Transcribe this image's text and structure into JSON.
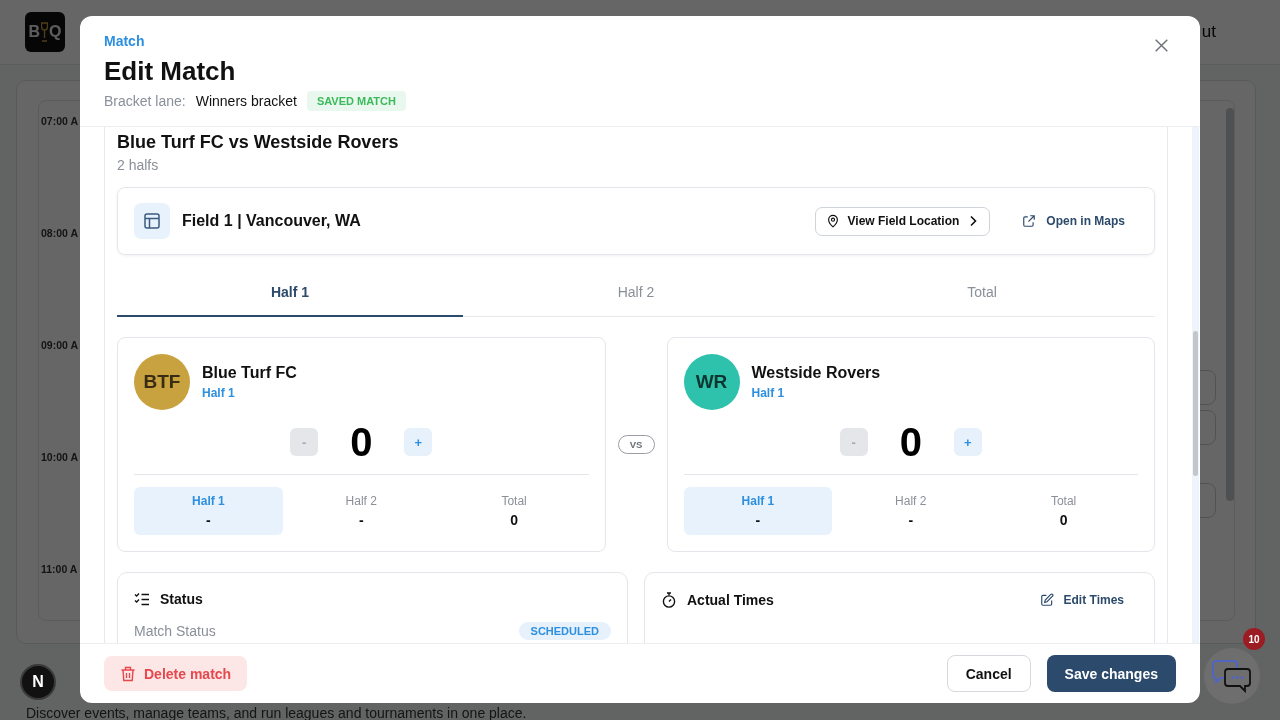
{
  "background": {
    "logo": {
      "letters": [
        "B",
        "Q"
      ]
    },
    "header_link": "ut",
    "time_labels": [
      "07:00 A",
      "08:00 A",
      "09:00 A",
      "10:00 A",
      "11:00 A"
    ],
    "tagline": "Discover events, manage teams, and run leagues and tournaments in one place.",
    "dev_indicator": "N",
    "chat": {
      "badge": "10"
    }
  },
  "modal": {
    "eyebrow": "Match",
    "title": "Edit Match",
    "lane_label": "Bracket lane:",
    "lane": "Winners bracket",
    "badge": "SAVED MATCH"
  },
  "match": {
    "title": "Blue Turf FC vs Westside Rovers",
    "subtitle": "2 halfs",
    "field": {
      "name": "Field 1 | Vancouver, WA",
      "location_button": "View Field Location",
      "maps_link": "Open in Maps"
    },
    "tabs": [
      {
        "label": "Half 1",
        "selected": true
      },
      {
        "label": "Half 2",
        "selected": false
      },
      {
        "label": "Total",
        "selected": false
      }
    ],
    "vs": "VS",
    "teams": [
      {
        "initials": "BTF",
        "color": "#c8a23f",
        "name": "Blue Turf FC",
        "period": "Half 1",
        "score": "0",
        "decrement": {
          "label": "-",
          "disabled": true
        },
        "increment": {
          "label": "+",
          "disabled": false
        },
        "breakdown": [
          {
            "label": "Half 1",
            "value": "-",
            "selected": true
          },
          {
            "label": "Half 2",
            "value": "-",
            "selected": false
          },
          {
            "label": "Total",
            "value": "0",
            "selected": false
          }
        ]
      },
      {
        "initials": "WR",
        "color": "#2ec2ad",
        "name": "Westside Rovers",
        "period": "Half 1",
        "score": "0",
        "decrement": {
          "label": "-",
          "disabled": true
        },
        "increment": {
          "label": "+",
          "disabled": false
        },
        "breakdown": [
          {
            "label": "Half 1",
            "value": "-",
            "selected": true
          },
          {
            "label": "Half 2",
            "value": "-",
            "selected": false
          },
          {
            "label": "Total",
            "value": "0",
            "selected": false
          }
        ]
      }
    ]
  },
  "status": {
    "title": "Status",
    "rows": [
      {
        "label": "Match Status",
        "value": "SCHEDULED"
      }
    ]
  },
  "actual_times": {
    "title": "Actual Times",
    "edit_button": "Edit Times"
  },
  "footer": {
    "delete_button": "Delete match",
    "cancel_button": "Cancel",
    "save_button": "Save changes"
  }
}
